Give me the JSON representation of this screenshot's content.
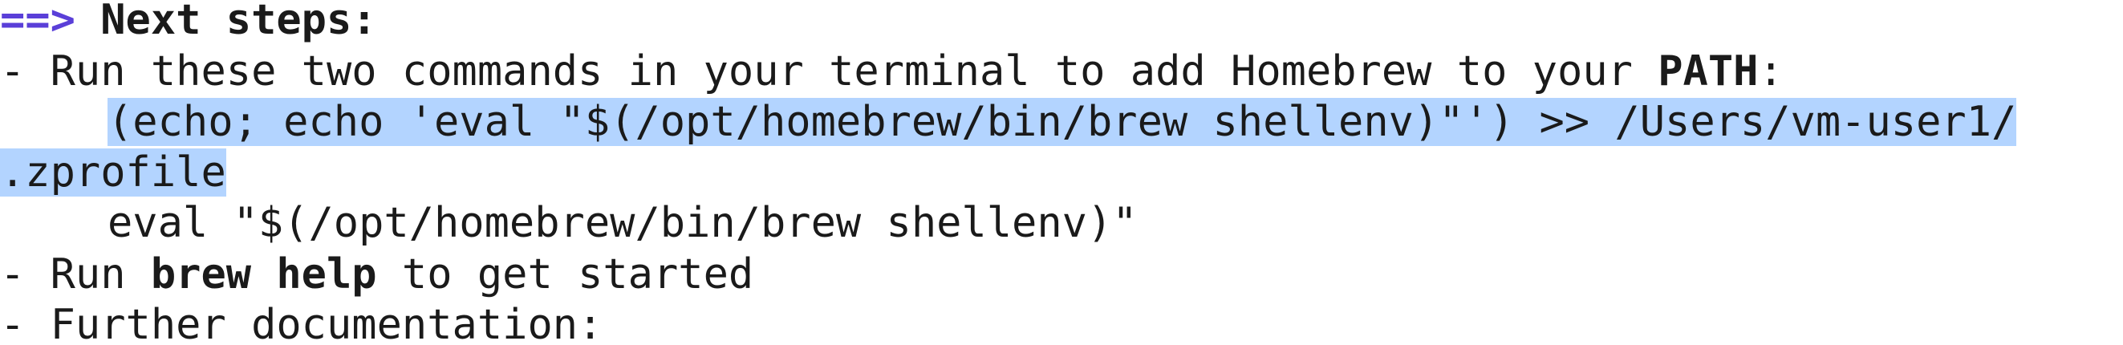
{
  "terminal": {
    "line0": {
      "arrow": "==>",
      "text": " Next steps:"
    },
    "line1": {
      "prefix": "- Run these two commands in your terminal to add Homebrew to your ",
      "bold": "PATH",
      "suffix": ":"
    },
    "line2": {
      "selected": "(echo; echo 'eval \"$(/opt/homebrew/bin/brew shellenv)\"') >> /Users/vm-user1/"
    },
    "line3": {
      "selected": ".zprofile"
    },
    "line4": {
      "text": "eval \"$(/opt/homebrew/bin/brew shellenv)\""
    },
    "line5": {
      "prefix": "- Run ",
      "bold": "brew help",
      "suffix": " to get started"
    },
    "line6": {
      "text": "- Further documentation:"
    }
  },
  "colors": {
    "arrow": "#5a3fd8",
    "selection": "#b3d4ff",
    "text": "#1a1a1a",
    "background": "#ffffff"
  }
}
